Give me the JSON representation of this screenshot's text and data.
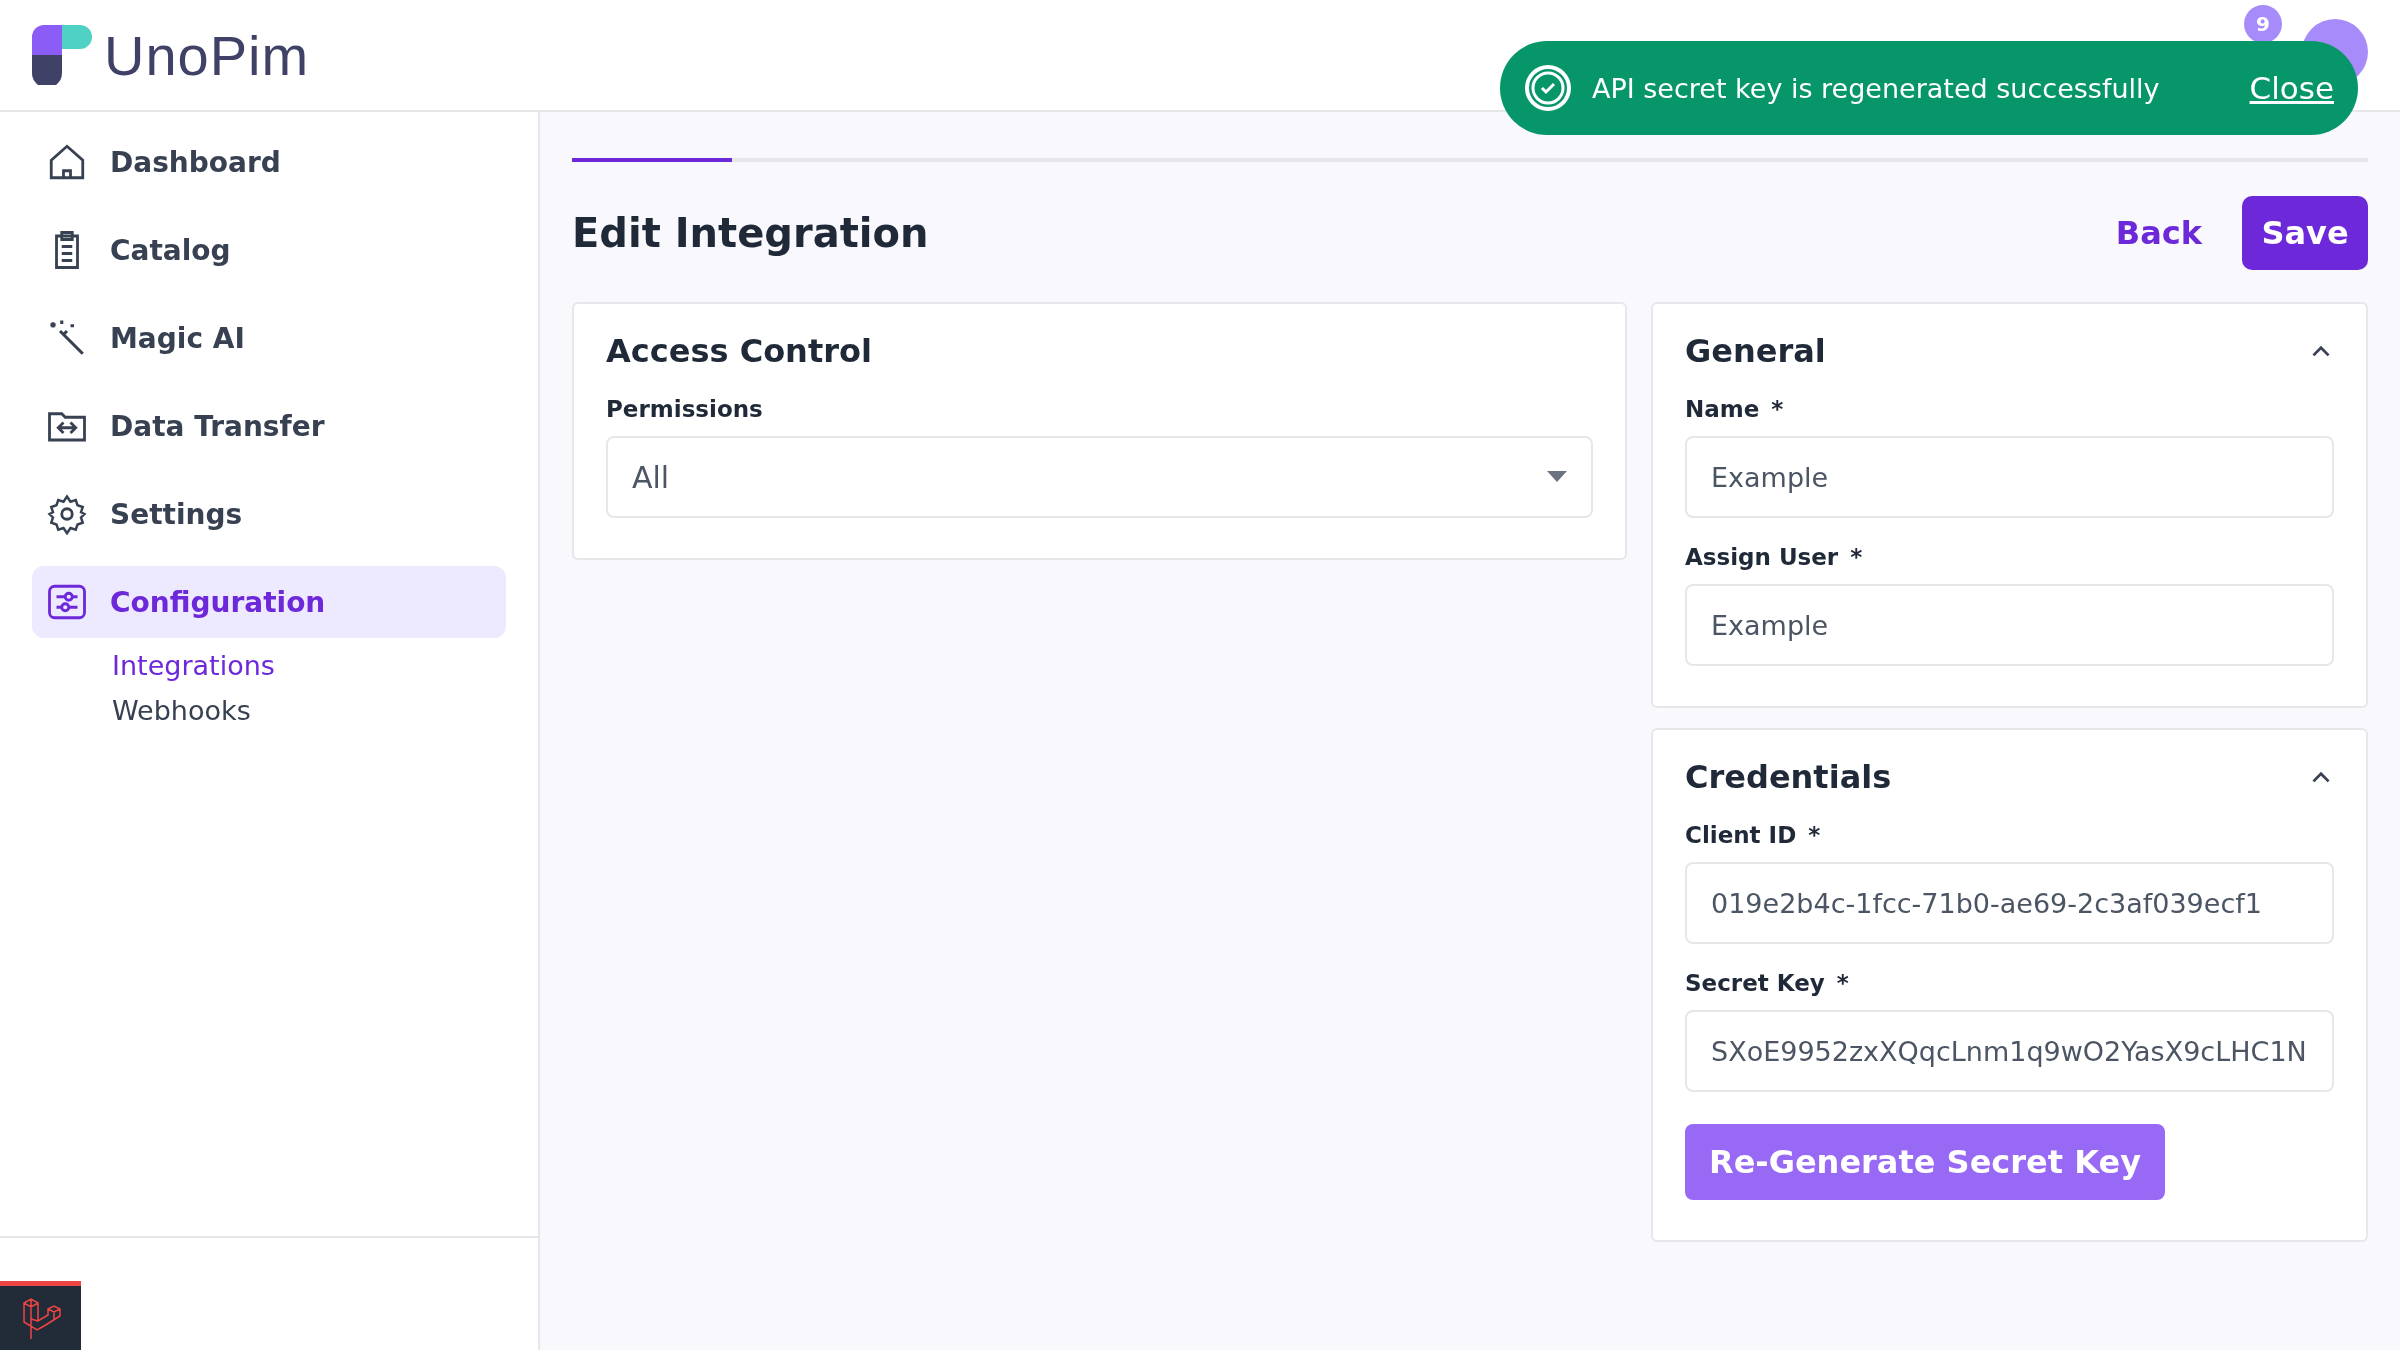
{
  "header": {
    "logo": "UnoPim",
    "notification_count": "9"
  },
  "toast": {
    "message": "API secret key is regenerated successfully",
    "action": "Close"
  },
  "sidebar": {
    "items": [
      {
        "label": "Dashboard",
        "selected": false
      },
      {
        "label": "Catalog",
        "selected": false
      },
      {
        "label": "Magic AI",
        "selected": false
      },
      {
        "label": "Data Transfer",
        "selected": false
      },
      {
        "label": "Settings",
        "selected": false
      },
      {
        "label": "Configuration",
        "selected": true,
        "children": [
          {
            "label": "Integrations",
            "selected": true
          },
          {
            "label": "Webhooks",
            "selected": false
          }
        ]
      }
    ]
  },
  "tabs": [
    {
      "selected": true
    },
    {
      "selected": false
    }
  ],
  "page": {
    "title": "Edit Integration",
    "back": "Back",
    "save": "Save"
  },
  "access_control": {
    "title": "Access Control",
    "permissions_label": "Permissions",
    "permissions_value": "All"
  },
  "general": {
    "title": "General",
    "expanded": true,
    "fields": [
      {
        "label": "Name",
        "marker": "*",
        "value": "Example"
      },
      {
        "label": "Assign User",
        "marker": "*",
        "value": "Example"
      }
    ]
  },
  "credentials": {
    "title": "Credentials",
    "expanded": true,
    "fields": [
      {
        "label": "Client ID",
        "marker": "*",
        "value": "019e2b4c-1fcc-71b0-ae69-2c3af039ecf1"
      },
      {
        "label": "Secret Key",
        "marker": "*",
        "value": "SXoE9952zxXQqcLnm1q9wO2YasX9cLHC1N"
      }
    ],
    "action": "Re-Generate Secret Key"
  }
}
